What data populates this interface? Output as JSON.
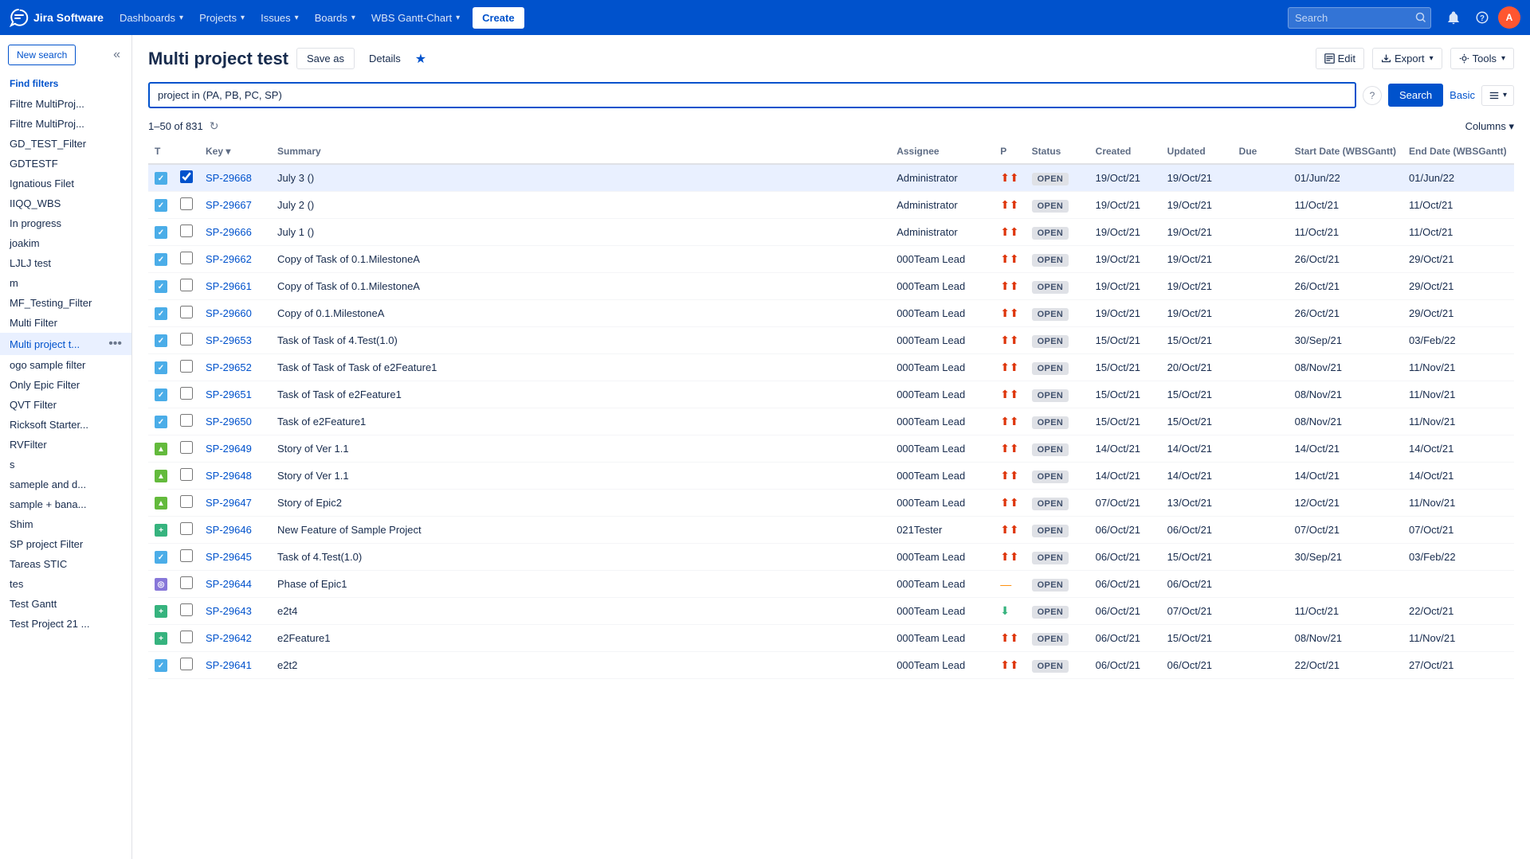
{
  "topnav": {
    "logo_text": "Jira Software",
    "links": [
      {
        "label": "Dashboards",
        "id": "dashboards"
      },
      {
        "label": "Projects",
        "id": "projects"
      },
      {
        "label": "Issues",
        "id": "issues"
      },
      {
        "label": "Boards",
        "id": "boards"
      },
      {
        "label": "WBS Gantt-Chart",
        "id": "wbs-gantt"
      }
    ],
    "create_label": "Create",
    "search_placeholder": "Search"
  },
  "sidebar": {
    "new_search_label": "New search",
    "collapse_icon": "«",
    "find_filters_label": "Find filters",
    "items": [
      {
        "label": "Filtre MultiProj...",
        "id": "filtre-multiproj-1",
        "active": false
      },
      {
        "label": "Filtre MultiProj...",
        "id": "filtre-multiproj-2",
        "active": false
      },
      {
        "label": "GD_TEST_Filter",
        "id": "gd-test-filter",
        "active": false
      },
      {
        "label": "GDTESTF",
        "id": "gdtestf",
        "active": false
      },
      {
        "label": "Ignatious Filet",
        "id": "ignatious-filet",
        "active": false
      },
      {
        "label": "IIQQ_WBS",
        "id": "iiqq-wbs",
        "active": false
      },
      {
        "label": "In progress",
        "id": "in-progress",
        "active": false
      },
      {
        "label": "joakim",
        "id": "joakim",
        "active": false
      },
      {
        "label": "LJLJ test",
        "id": "ljlj-test",
        "active": false
      },
      {
        "label": "m",
        "id": "m",
        "active": false
      },
      {
        "label": "MF_Testing_Filter",
        "id": "mf-testing-filter",
        "active": false
      },
      {
        "label": "Multi Filter",
        "id": "multi-filter",
        "active": false
      },
      {
        "label": "Multi project t...",
        "id": "multi-project-t",
        "active": true
      },
      {
        "label": "ogo sample filter",
        "id": "ogo-sample-filter",
        "active": false
      },
      {
        "label": "Only Epic Filter",
        "id": "only-epic-filter",
        "active": false
      },
      {
        "label": "QVT Filter",
        "id": "qvt-filter",
        "active": false
      },
      {
        "label": "Ricksoft Starter...",
        "id": "ricksoft-starter",
        "active": false
      },
      {
        "label": "RVFilter",
        "id": "rvfilter",
        "active": false
      },
      {
        "label": "s",
        "id": "s",
        "active": false
      },
      {
        "label": "sameple and d...",
        "id": "sameple-and-d",
        "active": false
      },
      {
        "label": "sample + bana...",
        "id": "sample-bana",
        "active": false
      },
      {
        "label": "Shim",
        "id": "shim",
        "active": false
      },
      {
        "label": "SP project Filter",
        "id": "sp-project-filter",
        "active": false
      },
      {
        "label": "Tareas STIC",
        "id": "tareas-stic",
        "active": false
      },
      {
        "label": "tes",
        "id": "tes",
        "active": false
      },
      {
        "label": "Test Gantt",
        "id": "test-gantt",
        "active": false
      },
      {
        "label": "Test Project 21 ...",
        "id": "test-project-21",
        "active": false
      }
    ]
  },
  "main": {
    "title": "Multi project test",
    "save_as_label": "Save as",
    "details_label": "Details",
    "edit_label": "Edit",
    "export_label": "Export",
    "tools_label": "Tools",
    "jql_query": "project in (PA, PB, PC, SP)",
    "search_label": "Search",
    "basic_label": "Basic",
    "results_count": "1–50 of 831",
    "columns_label": "Columns",
    "table_headers": [
      {
        "label": "T",
        "id": "type"
      },
      {
        "label": "Key",
        "id": "key"
      },
      {
        "label": "Summary",
        "id": "summary"
      },
      {
        "label": "Assignee",
        "id": "assignee"
      },
      {
        "label": "P",
        "id": "priority"
      },
      {
        "label": "Status",
        "id": "status"
      },
      {
        "label": "Created",
        "id": "created"
      },
      {
        "label": "Updated",
        "id": "updated"
      },
      {
        "label": "Due",
        "id": "due"
      },
      {
        "label": "Start Date (WBSGantt)",
        "id": "wbs-start"
      },
      {
        "label": "End Date (WBSGantt)",
        "id": "wbs-end"
      }
    ],
    "rows": [
      {
        "type": "task",
        "key": "SP-29668",
        "summary": "July 3 ()",
        "assignee": "Administrator",
        "priority": "high",
        "status": "OPEN",
        "created": "19/Oct/21",
        "updated": "19/Oct/21",
        "due": "",
        "wbs_start": "01/Jun/22",
        "wbs_end": "01/Jun/22",
        "selected": true
      },
      {
        "type": "task",
        "key": "SP-29667",
        "summary": "July 2 ()",
        "assignee": "Administrator",
        "priority": "high",
        "status": "OPEN",
        "created": "19/Oct/21",
        "updated": "19/Oct/21",
        "due": "",
        "wbs_start": "11/Oct/21",
        "wbs_end": "11/Oct/21",
        "selected": false
      },
      {
        "type": "task",
        "key": "SP-29666",
        "summary": "July 1 ()",
        "assignee": "Administrator",
        "priority": "high",
        "status": "OPEN",
        "created": "19/Oct/21",
        "updated": "19/Oct/21",
        "due": "",
        "wbs_start": "11/Oct/21",
        "wbs_end": "11/Oct/21",
        "selected": false
      },
      {
        "type": "task",
        "key": "SP-29662",
        "summary": "Copy of Task of 0.1.MilestoneA",
        "assignee": "000Team Lead",
        "priority": "high",
        "status": "OPEN",
        "created": "19/Oct/21",
        "updated": "19/Oct/21",
        "due": "",
        "wbs_start": "26/Oct/21",
        "wbs_end": "29/Oct/21",
        "selected": false
      },
      {
        "type": "task",
        "key": "SP-29661",
        "summary": "Copy of Task of 0.1.MilestoneA",
        "assignee": "000Team Lead",
        "priority": "high",
        "status": "OPEN",
        "created": "19/Oct/21",
        "updated": "19/Oct/21",
        "due": "",
        "wbs_start": "26/Oct/21",
        "wbs_end": "29/Oct/21",
        "selected": false
      },
      {
        "type": "task",
        "key": "SP-29660",
        "summary": "Copy of 0.1.MilestoneA",
        "assignee": "000Team Lead",
        "priority": "high",
        "status": "OPEN",
        "created": "19/Oct/21",
        "updated": "19/Oct/21",
        "due": "",
        "wbs_start": "26/Oct/21",
        "wbs_end": "29/Oct/21",
        "selected": false
      },
      {
        "type": "task",
        "key": "SP-29653",
        "summary": "Task of Task of 4.Test(1.0)",
        "assignee": "000Team Lead",
        "priority": "high",
        "status": "OPEN",
        "created": "15/Oct/21",
        "updated": "15/Oct/21",
        "due": "",
        "wbs_start": "30/Sep/21",
        "wbs_end": "03/Feb/22",
        "selected": false
      },
      {
        "type": "task",
        "key": "SP-29652",
        "summary": "Task of Task of Task of e2Feature1",
        "assignee": "000Team Lead",
        "priority": "high",
        "status": "OPEN",
        "created": "15/Oct/21",
        "updated": "20/Oct/21",
        "due": "",
        "wbs_start": "08/Nov/21",
        "wbs_end": "11/Nov/21",
        "selected": false
      },
      {
        "type": "task",
        "key": "SP-29651",
        "summary": "Task of Task of e2Feature1",
        "assignee": "000Team Lead",
        "priority": "high",
        "status": "OPEN",
        "created": "15/Oct/21",
        "updated": "15/Oct/21",
        "due": "",
        "wbs_start": "08/Nov/21",
        "wbs_end": "11/Nov/21",
        "selected": false
      },
      {
        "type": "task",
        "key": "SP-29650",
        "summary": "Task of e2Feature1",
        "assignee": "000Team Lead",
        "priority": "high",
        "status": "OPEN",
        "created": "15/Oct/21",
        "updated": "15/Oct/21",
        "due": "",
        "wbs_start": "08/Nov/21",
        "wbs_end": "11/Nov/21",
        "selected": false
      },
      {
        "type": "story",
        "key": "SP-29649",
        "summary": "Story of Ver 1.1",
        "assignee": "000Team Lead",
        "priority": "high",
        "status": "OPEN",
        "created": "14/Oct/21",
        "updated": "14/Oct/21",
        "due": "",
        "wbs_start": "14/Oct/21",
        "wbs_end": "14/Oct/21",
        "selected": false
      },
      {
        "type": "story",
        "key": "SP-29648",
        "summary": "Story of Ver 1.1",
        "assignee": "000Team Lead",
        "priority": "high",
        "status": "OPEN",
        "created": "14/Oct/21",
        "updated": "14/Oct/21",
        "due": "",
        "wbs_start": "14/Oct/21",
        "wbs_end": "14/Oct/21",
        "selected": false
      },
      {
        "type": "story",
        "key": "SP-29647",
        "summary": "Story of Epic2",
        "assignee": "000Team Lead",
        "priority": "high",
        "status": "OPEN",
        "created": "07/Oct/21",
        "updated": "13/Oct/21",
        "due": "",
        "wbs_start": "12/Oct/21",
        "wbs_end": "11/Nov/21",
        "selected": false
      },
      {
        "type": "feature",
        "key": "SP-29646",
        "summary": "New Feature of Sample Project",
        "assignee": "021Tester",
        "priority": "high",
        "status": "OPEN",
        "created": "06/Oct/21",
        "updated": "06/Oct/21",
        "due": "",
        "wbs_start": "07/Oct/21",
        "wbs_end": "07/Oct/21",
        "selected": false
      },
      {
        "type": "task",
        "key": "SP-29645",
        "summary": "Task of 4.Test(1.0)",
        "assignee": "000Team Lead",
        "priority": "high",
        "status": "OPEN",
        "created": "06/Oct/21",
        "updated": "15/Oct/21",
        "due": "",
        "wbs_start": "30/Sep/21",
        "wbs_end": "03/Feb/22",
        "selected": false
      },
      {
        "type": "phase",
        "key": "SP-29644",
        "summary": "Phase of Epic1",
        "assignee": "000Team Lead",
        "priority": "medium",
        "status": "OPEN",
        "created": "06/Oct/21",
        "updated": "06/Oct/21",
        "due": "",
        "wbs_start": "",
        "wbs_end": "",
        "selected": false
      },
      {
        "type": "feature",
        "key": "SP-29643",
        "summary": "e2t4",
        "assignee": "000Team Lead",
        "priority": "low",
        "status": "OPEN",
        "created": "06/Oct/21",
        "updated": "07/Oct/21",
        "due": "",
        "wbs_start": "11/Oct/21",
        "wbs_end": "22/Oct/21",
        "selected": false
      },
      {
        "type": "feature",
        "key": "SP-29642",
        "summary": "e2Feature1",
        "assignee": "000Team Lead",
        "priority": "high",
        "status": "OPEN",
        "created": "06/Oct/21",
        "updated": "15/Oct/21",
        "due": "",
        "wbs_start": "08/Nov/21",
        "wbs_end": "11/Nov/21",
        "selected": false
      },
      {
        "type": "task",
        "key": "SP-29641",
        "summary": "e2t2",
        "assignee": "000Team Lead",
        "priority": "high",
        "status": "OPEN",
        "created": "06/Oct/21",
        "updated": "06/Oct/21",
        "due": "",
        "wbs_start": "22/Oct/21",
        "wbs_end": "27/Oct/21",
        "selected": false
      }
    ]
  }
}
